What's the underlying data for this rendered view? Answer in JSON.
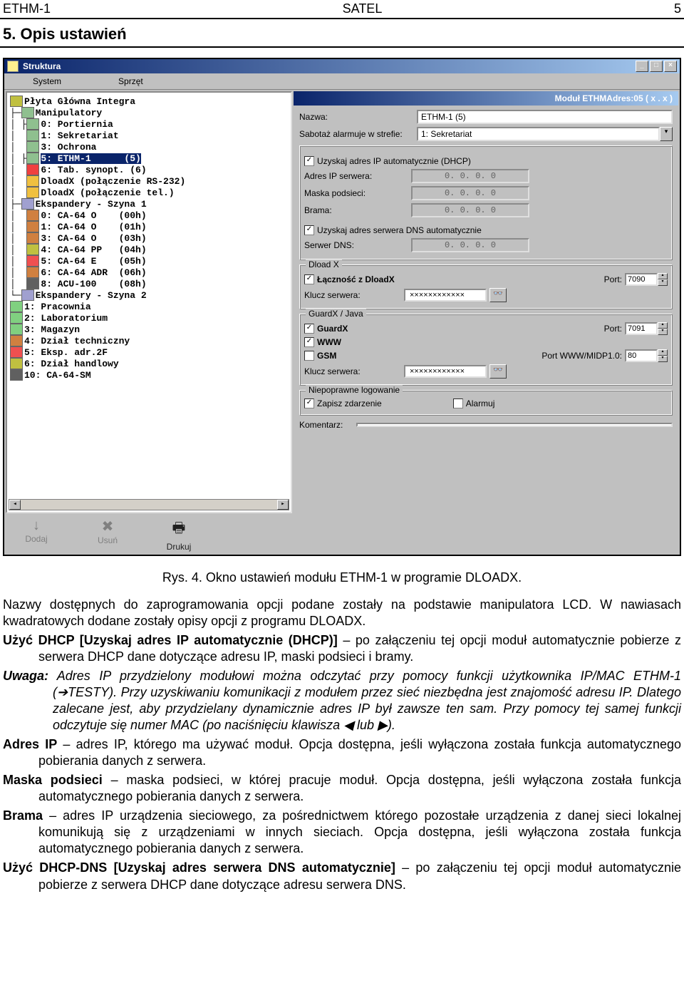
{
  "header": {
    "left": "ETHM-1",
    "center": "SATEL",
    "right": "5"
  },
  "section_title": "5.  Opis ustawień",
  "window": {
    "title": "Struktura",
    "menu": {
      "system": "System",
      "sprzet": "Sprzęt"
    },
    "win_btns": {
      "min": "_",
      "max": "□",
      "close": "×"
    }
  },
  "tree": {
    "root": "Płyta Główna Integra",
    "manip": "Manipulatory",
    "m0": "0: Portiernia",
    "m1": "1: Sekretariat",
    "m3": "3: Ochrona",
    "m5": "5: ETHM-1      (5)",
    "m6": "6: Tab. synopt. (6)",
    "d1": "DloadX (połączenie RS-232)",
    "d2": "DloadX (połączenie tel.)",
    "exp1": "Ekspandery - Szyna 1",
    "e0": "0: CA-64 O    (00h)",
    "e1": "1: CA-64 O    (01h)",
    "e3": "3: CA-64 O    (03h)",
    "e4": "4: CA-64 PP   (04h)",
    "e5": "5: CA-64 E    (05h)",
    "e6": "6: CA-64 ADR  (06h)",
    "e8": "8: ACU-100    (08h)",
    "exp2": "Ekspandery - Szyna 2",
    "f1": "1: Pracownia",
    "f2": "2: Laboratorium",
    "f3": "3: Magazyn",
    "f4": "4: Dział techniczny",
    "f5": "5: Eksp. adr.2F",
    "f6": "6: Dział handlowy",
    "f10": "10: CA-64-SM"
  },
  "toolbar": {
    "add": "Dodaj",
    "del": "Usuń",
    "print": "Drukuj",
    "add_glyph": "↓",
    "del_glyph": "✖",
    "print_glyph": "🖶"
  },
  "right": {
    "title": "Moduł ETHMAdres:05 ( x . x )",
    "name_lab": "Nazwa:",
    "name_val": "ETHM-1      (5)",
    "sabot_lab": "Sabotaż alarmuje w strefie:",
    "sabot_val": "1: Sekretariat",
    "dhcp_chk": "Uzyskaj adres IP automatycznie (DHCP)",
    "ip_lab": "Adres IP serwera:",
    "mask_lab": "Maska podsieci:",
    "gw_lab": "Brama:",
    "ip_val": "0.   0.   0.   0",
    "dns_chk": "Uzyskaj adres serwera DNS automatycznie",
    "dns_lab": "Serwer DNS:",
    "dloadx_title": "Dload X",
    "dloadx_chk": "Łączność z DloadX",
    "port_lab": "Port:",
    "port1": "7090",
    "key_lab": "Klucz serwera:",
    "key_val": "××××××××××××",
    "guardx_title": "GuardX / Java",
    "guardx_chk": "GuardX",
    "www_chk": "WWW",
    "gsm_chk": "GSM",
    "port2": "7091",
    "portwww_lab": "Port WWW/MIDP1.0:",
    "portwww": "80",
    "badlog_title": "Niepoprawne logowanie",
    "log_chk": "Zapisz zdarzenie",
    "alarm_chk": "Alarmuj",
    "comment_lab": "Komentarz:",
    "comment_val": "",
    "eye": "👓"
  },
  "caption": "Rys. 4. Okno ustawień modułu ETHM-1 w programie DLOADX.",
  "body": {
    "p1a": "Nazwy dostępnych do zaprogramowania opcji podane zostały na podstawie manipulatora LCD. W nawiasach kwadratowych dodane zostały opisy opcji z programu D",
    "p1b": "LOAD",
    "p1c": "X.",
    "p2a": "Użyć DHCP [Uzyskaj adres IP automatycznie (DHCP)]",
    "p2b": " – po załączeniu tej opcji moduł automatycznie pobierze z serwera DHCP dane dotyczące adresu IP, maski podsieci i bramy.",
    "uwaga_lab": "Uwaga:",
    "uwaga_a": " Adres IP przydzielony modułowi można odczytać przy pomocy funkcji użytkownika IP/MAC ETHM-1 (",
    "uwaga_arrow": "➔",
    "uwaga_testy": "TESTY",
    "uwaga_b": "). Przy uzyskiwaniu komunikacji z modułem przez sieć niezbędna jest znajomość adresu IP. Dlatego zalecane jest, aby przydzielany dynamicznie adres IP był zawsze ten sam. Przy pomocy tej samej funkcji odczytuje się numer MAC (po naciśnięciu klawisza ◀ lub ▶).",
    "p3a": "Adres IP",
    "p3b": " – adres IP, którego ma używać moduł. Opcja dostępna, jeśli wyłączona została funkcja automatycznego pobierania danych z serwera.",
    "p4a": "Maska podsieci",
    "p4b": " – maska podsieci, w której pracuje moduł. Opcja dostępna, jeśli wyłączona została funkcja automatycznego pobierania danych z serwera.",
    "p5a": "Brama",
    "p5b": " – adres IP urządzenia sieciowego, za pośrednictwem którego pozostałe urządzenia z danej sieci lokalnej komunikują się z urządzeniami w innych sieciach. Opcja dostępna, jeśli wyłączona została funkcja automatycznego pobierania danych z serwera.",
    "p6a": "Użyć DHCP-DNS [Uzyskaj adres serwera DNS automatycznie]",
    "p6b": " – po załączeniu tej opcji moduł automatycznie pobierze z serwera DHCP dane dotyczące adresu serwera DNS."
  }
}
